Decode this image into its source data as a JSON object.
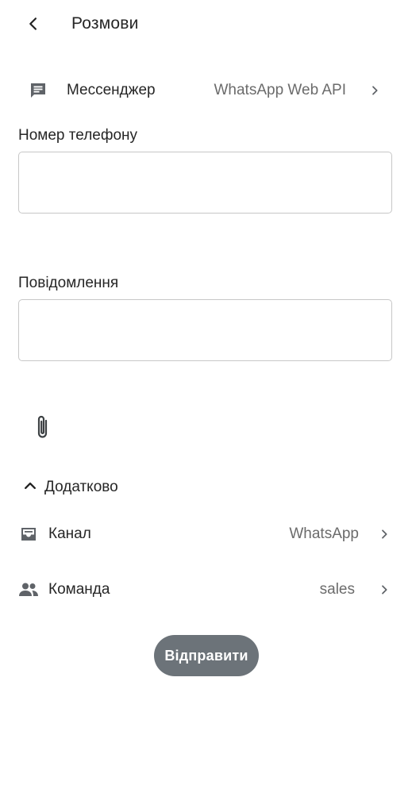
{
  "header": {
    "title": "Розмови",
    "back_icon": "chevron-left-icon"
  },
  "messenger": {
    "icon": "message-icon",
    "label": "Мессенджер",
    "value": "WhatsApp Web API"
  },
  "phone": {
    "label": "Номер телефону",
    "value": "",
    "placeholder": ""
  },
  "message": {
    "label": "Повідомлення",
    "value": "",
    "placeholder": ""
  },
  "attachment": {
    "icon": "paperclip-icon"
  },
  "extra": {
    "label": "Додатково",
    "icon": "chevron-up-icon",
    "expanded": true
  },
  "channel": {
    "icon": "inbox-icon",
    "label": "Канал",
    "value": "WhatsApp"
  },
  "team": {
    "icon": "people-icon",
    "label": "Команда",
    "value": "sales"
  },
  "actions": {
    "send_label": "Відправити"
  },
  "colors": {
    "text": "#262626",
    "secondary_text": "#6b6b6b",
    "icon": "#5f6368",
    "border": "#c7c7c7",
    "send_button_bg": "#6c7379",
    "send_button_text": "#ffffff"
  }
}
